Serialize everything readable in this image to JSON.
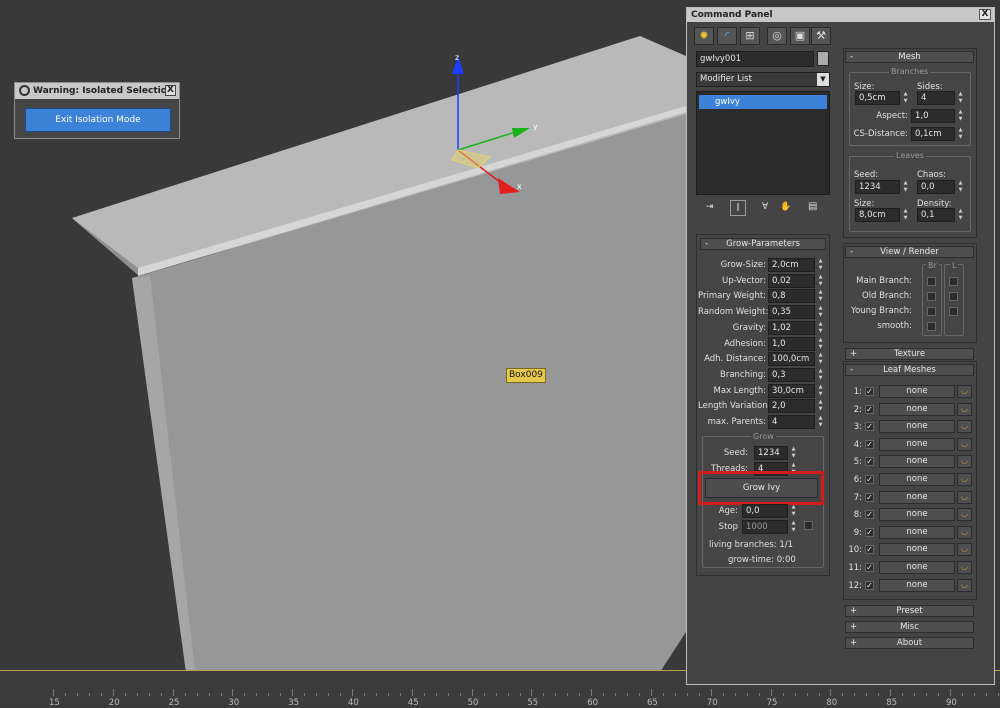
{
  "warning": {
    "title": "Warning: Isolated Selection",
    "close": "X",
    "exit_label": "Exit Isolation Mode"
  },
  "viewport": {
    "object_label": "Box009",
    "gizmo": {
      "x": "x",
      "y": "y",
      "z": "z"
    },
    "ruler": [
      15,
      20,
      25,
      30,
      35,
      40,
      45,
      50,
      55,
      60,
      65,
      70,
      75,
      80,
      85,
      90
    ]
  },
  "command_panel": {
    "title": "Command Panel",
    "close": "X",
    "tabs": [
      "create-icon",
      "modify-icon",
      "hierarchy-icon",
      "motion-icon",
      "display-icon",
      "utilities-icon"
    ],
    "object_name": "gwIvy001",
    "modifier_list": "Modifier List",
    "stack_item": "gwIvy",
    "grow_params": {
      "header": "Grow-Parameters",
      "rows": [
        {
          "label": "Grow-Size:",
          "value": "2,0cm"
        },
        {
          "label": "Up-Vector:",
          "value": "0,02"
        },
        {
          "label": "Primary Weight:",
          "value": "0,8"
        },
        {
          "label": "Random Weight:",
          "value": "0,35"
        },
        {
          "label": "Gravity:",
          "value": "1,02"
        },
        {
          "label": "Adhesion:",
          "value": "1,0"
        },
        {
          "label": "Adh. Distance:",
          "value": "100,0cm"
        },
        {
          "label": "Branching:",
          "value": "0,3"
        },
        {
          "label": "Max Length:",
          "value": "30,0cm"
        },
        {
          "label": "Length Variation:",
          "value": "2,0"
        },
        {
          "label": "max. Parents:",
          "value": "4"
        }
      ],
      "grow_group": "Grow",
      "seed_label": "Seed:",
      "seed_value": "1234",
      "threads_label": "Threads:",
      "threads_value": "4",
      "grow_button": "Grow Ivy",
      "age_label": "Age:",
      "age_value": "0,0",
      "stop_label": "Stop",
      "stop_value": "1000",
      "living_branches": "living branches: 1/1",
      "grow_time": "grow-time: 0:00"
    },
    "mesh": {
      "header": "Mesh",
      "branches_group": "Branches",
      "size_label": "Size:",
      "size_value": "0,5cm",
      "sides_label": "Sides:",
      "sides_value": "4",
      "aspect_label": "Aspect:",
      "aspect_value": "1,0",
      "cs_label": "CS-Distance:",
      "cs_value": "0,1cm",
      "leaves_group": "Leaves",
      "seed_label": "Seed:",
      "seed_value": "1234",
      "chaos_label": "Chaos:",
      "chaos_value": "0,0",
      "lsize_label": "Size:",
      "lsize_value": "8,0cm",
      "density_label": "Density:",
      "density_value": "0,1"
    },
    "view_render": {
      "header": "View / Render",
      "col_br": "Br",
      "col_l": "L",
      "rows": [
        "Main Branch:",
        "Old Branch:",
        "Young Branch:",
        "smooth:"
      ]
    },
    "texture": {
      "header": "Texture"
    },
    "leaf_meshes": {
      "header": "Leaf Meshes",
      "items": [
        {
          "num": "1:",
          "value": "none"
        },
        {
          "num": "2:",
          "value": "none"
        },
        {
          "num": "3:",
          "value": "none"
        },
        {
          "num": "4:",
          "value": "none"
        },
        {
          "num": "5:",
          "value": "none"
        },
        {
          "num": "6:",
          "value": "none"
        },
        {
          "num": "7:",
          "value": "none"
        },
        {
          "num": "8:",
          "value": "none"
        },
        {
          "num": "9:",
          "value": "none"
        },
        {
          "num": "10:",
          "value": "none"
        },
        {
          "num": "11:",
          "value": "none"
        },
        {
          "num": "12:",
          "value": "none"
        }
      ]
    },
    "rollups": {
      "preset": "Preset",
      "misc": "Misc",
      "about": "About"
    },
    "colors": {
      "accent": "#3c82d8",
      "highlight": "#d21b1b",
      "label": "#e6c94a"
    }
  }
}
